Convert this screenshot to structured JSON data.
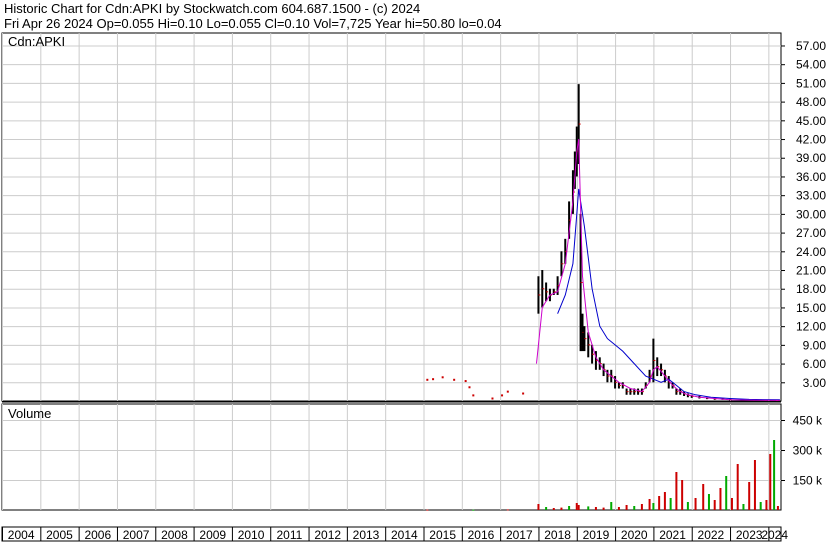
{
  "header": {
    "line1": "Historic Chart for Cdn:APKI by Stockwatch.com 604.687.1500 - (c) 2024",
    "line2": "Fri Apr 26 2024   Op=0.055   Hi=0.10   Lo=0.055   Cl=0.10   Vol=7,725   Year hi=50.80   lo=0.04"
  },
  "chart_data": {
    "type": "candlestick_with_volume",
    "symbol": "Cdn:APKI",
    "price_panel": {
      "label": "Cdn:APKI",
      "y_ticks": [
        3,
        6,
        9,
        12,
        15,
        18,
        21,
        24,
        27,
        30,
        33,
        36,
        39,
        42,
        45,
        48,
        51,
        54,
        57
      ],
      "y_tick_labels": [
        "3.00",
        "6.00",
        "9.00",
        "12.00",
        "15.00",
        "18.00",
        "21.00",
        "24.00",
        "27.00",
        "30.00",
        "33.00",
        "36.00",
        "39.00",
        "42.00",
        "45.00",
        "48.00",
        "51.00",
        "54.00",
        "57.00"
      ],
      "ylim": [
        0,
        59
      ],
      "series": {
        "high_low": [
          [
            2015.1,
            3.4,
            3.4
          ],
          [
            2015.25,
            3.5,
            3.5
          ],
          [
            2015.5,
            3.8,
            3.8
          ],
          [
            2015.8,
            3.4,
            3.4
          ],
          [
            2016.1,
            3.2,
            3.2
          ],
          [
            2016.2,
            2.2,
            2.2
          ],
          [
            2016.3,
            0.9,
            0.9
          ],
          [
            2016.8,
            0.4,
            0.4
          ],
          [
            2017.05,
            0.9,
            0.9
          ],
          [
            2017.2,
            1.5,
            1.5
          ],
          [
            2017.6,
            1.2,
            1.2
          ],
          [
            2018.0,
            14,
            20
          ],
          [
            2018.1,
            15,
            21
          ],
          [
            2018.2,
            16,
            19
          ],
          [
            2018.3,
            16,
            18
          ],
          [
            2018.4,
            17,
            18
          ],
          [
            2018.5,
            17,
            20
          ],
          [
            2018.6,
            20,
            24
          ],
          [
            2018.7,
            22,
            26
          ],
          [
            2018.8,
            26,
            32
          ],
          [
            2018.9,
            30,
            37
          ],
          [
            2018.95,
            34,
            40
          ],
          [
            2019.0,
            36,
            44
          ],
          [
            2019.05,
            38,
            50.8
          ],
          [
            2019.1,
            8,
            30
          ],
          [
            2019.15,
            8,
            14
          ],
          [
            2019.2,
            8,
            12
          ],
          [
            2019.3,
            7,
            11
          ],
          [
            2019.4,
            6,
            9
          ],
          [
            2019.5,
            5,
            8
          ],
          [
            2019.6,
            5,
            7
          ],
          [
            2019.7,
            4,
            6
          ],
          [
            2019.8,
            3,
            5
          ],
          [
            2019.9,
            3,
            5
          ],
          [
            2020.0,
            2,
            4
          ],
          [
            2020.1,
            2,
            3
          ],
          [
            2020.2,
            2,
            3
          ],
          [
            2020.3,
            1,
            2
          ],
          [
            2020.4,
            1,
            2
          ],
          [
            2020.5,
            1,
            2
          ],
          [
            2020.6,
            1,
            2
          ],
          [
            2020.7,
            1,
            2
          ],
          [
            2020.8,
            2,
            3
          ],
          [
            2020.9,
            3,
            5
          ],
          [
            2021.0,
            3,
            10
          ],
          [
            2021.1,
            4,
            7
          ],
          [
            2021.2,
            4,
            6
          ],
          [
            2021.3,
            3,
            5
          ],
          [
            2021.4,
            2,
            4
          ],
          [
            2021.5,
            2,
            3
          ],
          [
            2021.6,
            1,
            2
          ],
          [
            2021.7,
            1,
            2
          ],
          [
            2021.8,
            0.8,
            1.5
          ],
          [
            2021.9,
            0.6,
            1.2
          ],
          [
            2022.0,
            0.5,
            1
          ],
          [
            2022.2,
            0.4,
            0.8
          ],
          [
            2022.4,
            0.3,
            0.6
          ],
          [
            2022.6,
            0.2,
            0.5
          ],
          [
            2022.8,
            0.2,
            0.4
          ],
          [
            2023.0,
            0.1,
            0.3
          ],
          [
            2023.3,
            0.1,
            0.3
          ],
          [
            2023.6,
            0.1,
            0.2
          ],
          [
            2023.9,
            0.05,
            0.2
          ],
          [
            2024.2,
            0.05,
            0.1
          ]
        ],
        "ma_short": [
          [
            2017.95,
            6
          ],
          [
            2018.1,
            15
          ],
          [
            2018.3,
            17
          ],
          [
            2018.5,
            17.5
          ],
          [
            2018.7,
            22
          ],
          [
            2018.9,
            32
          ],
          [
            2019.0,
            40
          ],
          [
            2019.05,
            42
          ],
          [
            2019.15,
            20
          ],
          [
            2019.3,
            11
          ],
          [
            2019.5,
            7
          ],
          [
            2019.7,
            5
          ],
          [
            2019.9,
            4
          ],
          [
            2020.1,
            3
          ],
          [
            2020.4,
            2
          ],
          [
            2020.7,
            1.5
          ],
          [
            2020.9,
            3
          ],
          [
            2021.0,
            5
          ],
          [
            2021.1,
            5.5
          ],
          [
            2021.3,
            4
          ],
          [
            2021.5,
            2.5
          ],
          [
            2021.7,
            1.5
          ],
          [
            2021.9,
            1
          ],
          [
            2022.2,
            0.6
          ],
          [
            2022.6,
            0.4
          ],
          [
            2023.0,
            0.2
          ],
          [
            2023.5,
            0.15
          ],
          [
            2024.3,
            0.1
          ]
        ],
        "ma_long": [
          [
            2018.5,
            14
          ],
          [
            2018.7,
            17
          ],
          [
            2018.9,
            22
          ],
          [
            2019.0,
            30
          ],
          [
            2019.05,
            34
          ],
          [
            2019.2,
            28
          ],
          [
            2019.4,
            18
          ],
          [
            2019.6,
            12
          ],
          [
            2019.8,
            10
          ],
          [
            2020.0,
            9
          ],
          [
            2020.2,
            8
          ],
          [
            2020.5,
            6
          ],
          [
            2020.8,
            4
          ],
          [
            2021.0,
            3.5
          ],
          [
            2021.2,
            3
          ],
          [
            2021.4,
            3.5
          ],
          [
            2021.6,
            2.5
          ],
          [
            2021.8,
            1.5
          ],
          [
            2022.1,
            1
          ],
          [
            2022.5,
            0.6
          ],
          [
            2023.0,
            0.4
          ],
          [
            2023.5,
            0.25
          ],
          [
            2024.3,
            0.2
          ]
        ]
      }
    },
    "volume_panel": {
      "label": "Volume",
      "y_ticks": [
        150000,
        300000,
        450000
      ],
      "y_tick_labels": [
        "150 k",
        "300 k",
        "450 k"
      ],
      "ylim": [
        0,
        530000
      ],
      "bars": [
        [
          2015.1,
          2000
        ],
        [
          2016.3,
          1500
        ],
        [
          2017.2,
          3000
        ],
        [
          2018.0,
          30000
        ],
        [
          2018.2,
          15000
        ],
        [
          2018.4,
          10000
        ],
        [
          2018.6,
          12000
        ],
        [
          2018.8,
          20000
        ],
        [
          2019.0,
          35000
        ],
        [
          2019.05,
          25000
        ],
        [
          2019.3,
          18000
        ],
        [
          2019.5,
          15000
        ],
        [
          2019.7,
          12000
        ],
        [
          2019.9,
          40000
        ],
        [
          2020.1,
          15000
        ],
        [
          2020.3,
          25000
        ],
        [
          2020.5,
          20000
        ],
        [
          2020.7,
          30000
        ],
        [
          2020.9,
          55000
        ],
        [
          2021.0,
          35000
        ],
        [
          2021.15,
          70000
        ],
        [
          2021.3,
          90000
        ],
        [
          2021.45,
          60000
        ],
        [
          2021.6,
          190000
        ],
        [
          2021.75,
          150000
        ],
        [
          2021.9,
          40000
        ],
        [
          2022.1,
          60000
        ],
        [
          2022.3,
          130000
        ],
        [
          2022.45,
          80000
        ],
        [
          2022.6,
          50000
        ],
        [
          2022.75,
          110000
        ],
        [
          2022.9,
          170000
        ],
        [
          2023.05,
          60000
        ],
        [
          2023.2,
          230000
        ],
        [
          2023.35,
          30000
        ],
        [
          2023.5,
          140000
        ],
        [
          2023.65,
          250000
        ],
        [
          2023.8,
          40000
        ],
        [
          2023.95,
          50000
        ],
        [
          2024.05,
          280000
        ],
        [
          2024.15,
          350000
        ],
        [
          2024.25,
          20000
        ]
      ]
    },
    "x_ticks": [
      "2004",
      "2005",
      "2006",
      "2007",
      "2008",
      "2009",
      "2010",
      "2011",
      "2012",
      "2013",
      "2014",
      "2015",
      "2016",
      "2017",
      "2018",
      "2019",
      "2020",
      "2021",
      "2022",
      "2023",
      "2024"
    ],
    "xlim": [
      2004,
      2024.33
    ],
    "colors": {
      "high_low": "#000000",
      "close_marks": "#cc0000",
      "ma_short": "#cc00cc",
      "ma_long": "#0000cc",
      "volume_up": "#00aa00",
      "volume_down": "#cc0000",
      "grid": "#cccccc"
    }
  }
}
